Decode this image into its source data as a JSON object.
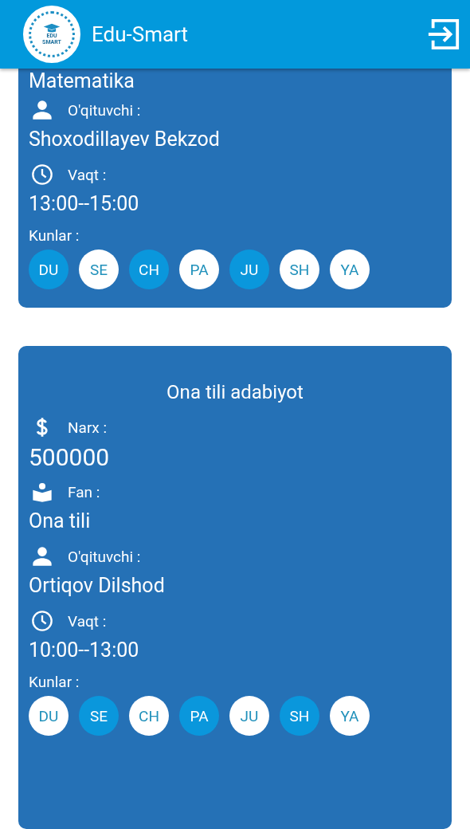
{
  "app_bar": {
    "logo_text": [
      "EDU",
      "SMART"
    ],
    "title": "Edu-Smart"
  },
  "cards": [
    {
      "rows": [
        {
          "kind": "plain",
          "value": "Matematika"
        },
        {
          "kind": "teacher",
          "label": "O'qituvchi :",
          "value": "Shoxodillayev Bekzod"
        },
        {
          "kind": "time",
          "label": "Vaqt :",
          "value": "13:00--15:00"
        }
      ],
      "days_label": "Kunlar :",
      "days": [
        {
          "label": "DU",
          "selected": true
        },
        {
          "label": "SE",
          "selected": false
        },
        {
          "label": "CH",
          "selected": true
        },
        {
          "label": "PA",
          "selected": false
        },
        {
          "label": "JU",
          "selected": true
        },
        {
          "label": "SH",
          "selected": false
        },
        {
          "label": "YA",
          "selected": false
        }
      ]
    },
    {
      "title": "Ona tili adabiyot",
      "rows": [
        {
          "kind": "price",
          "label": "Narx :",
          "value": "500000"
        },
        {
          "kind": "subject",
          "label": "Fan :",
          "value": "Ona tili"
        },
        {
          "kind": "teacher",
          "label": "O'qituvchi :",
          "value": "Ortiqov Dilshod"
        },
        {
          "kind": "time",
          "label": "Vaqt :",
          "value": "10:00--13:00"
        }
      ],
      "days_label": "Kunlar :",
      "days": [
        {
          "label": "DU",
          "selected": false
        },
        {
          "label": "SE",
          "selected": true
        },
        {
          "label": "CH",
          "selected": false
        },
        {
          "label": "PA",
          "selected": true
        },
        {
          "label": "JU",
          "selected": false
        },
        {
          "label": "SH",
          "selected": true
        },
        {
          "label": "YA",
          "selected": false
        }
      ]
    }
  ]
}
